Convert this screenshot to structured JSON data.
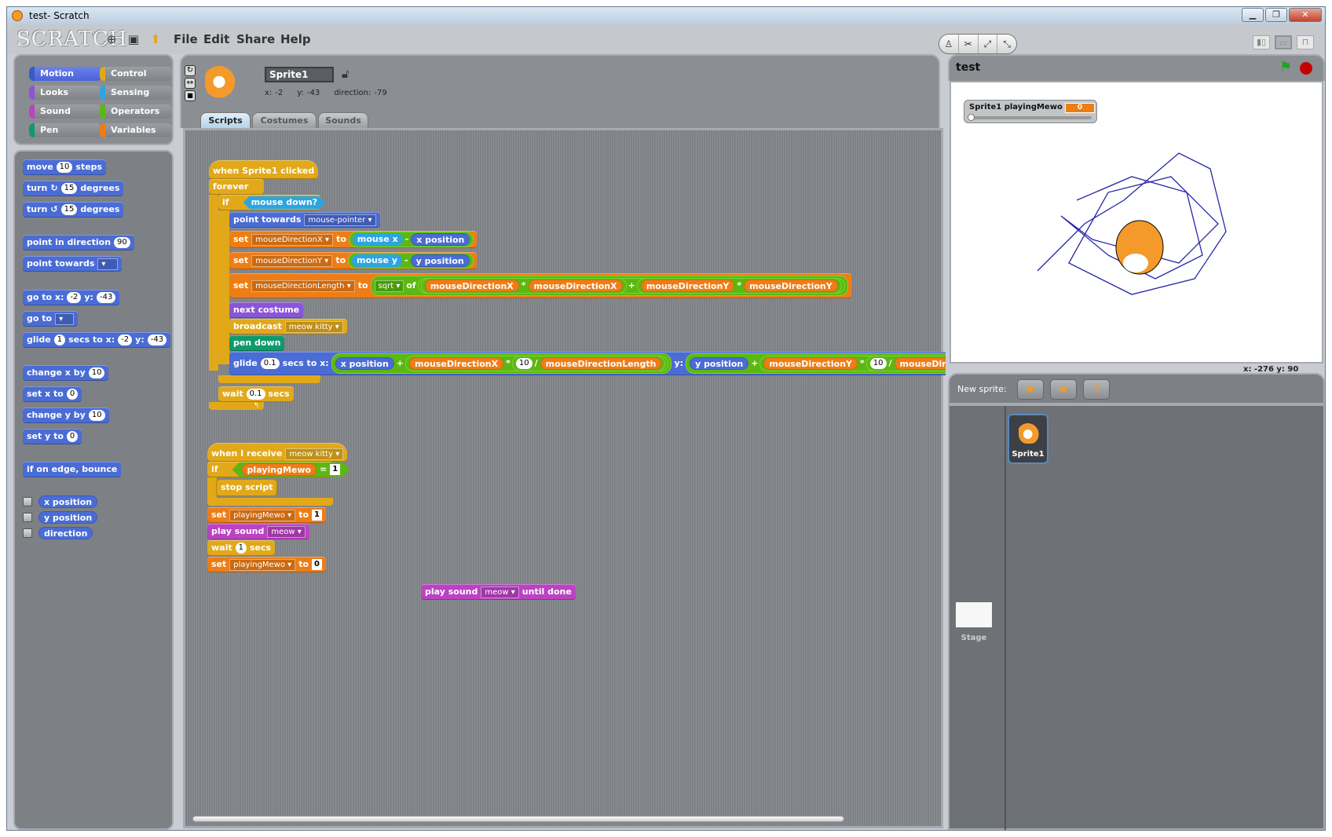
{
  "window": {
    "title": "test- Scratch",
    "min": "▁",
    "max": "❐",
    "close": "✕"
  },
  "menubar": {
    "logo": "SCRATCH",
    "icons": [
      "globe-icon",
      "save-icon",
      "share-icon"
    ],
    "items": [
      "File",
      "Edit",
      "Share",
      "Help"
    ],
    "tools": [
      "stamp-icon",
      "cut-icon",
      "grow-icon",
      "shrink-icon"
    ],
    "tool_glyphs": [
      "♙",
      "✂",
      "⤢",
      "⤡"
    ]
  },
  "categories": [
    {
      "label": "Motion",
      "color": "#4a6cd4",
      "selected": true
    },
    {
      "label": "Control",
      "color": "#e1a91a"
    },
    {
      "label": "Looks",
      "color": "#8a55d7"
    },
    {
      "label": "Sensing",
      "color": "#2ca5e2"
    },
    {
      "label": "Sound",
      "color": "#bb42c3"
    },
    {
      "label": "Operators",
      "color": "#5cb712"
    },
    {
      "label": "Pen",
      "color": "#0e9a6c"
    },
    {
      "label": "Variables",
      "color": "#ee7d16"
    }
  ],
  "palette": {
    "move": {
      "a": "move",
      "n": "10",
      "b": "steps"
    },
    "turn_cw": {
      "a": "turn",
      "g": "↻",
      "n": "15",
      "b": "degrees"
    },
    "turn_ccw": {
      "a": "turn",
      "g": "↺",
      "n": "15",
      "b": "degrees"
    },
    "point_dir": {
      "a": "point in direction",
      "v": "90"
    },
    "point_towards": {
      "a": "point towards",
      "v": ""
    },
    "goto_xy": {
      "a": "go to x:",
      "x": "-2",
      "y_label": "y:",
      "y": "-43"
    },
    "goto": {
      "a": "go to",
      "v": ""
    },
    "glide": {
      "a": "glide",
      "n": "1",
      "b": "secs to x:",
      "x": "-2",
      "y_label": "y:",
      "y": "-43"
    },
    "change_x": {
      "a": "change x by",
      "n": "10"
    },
    "set_x": {
      "a": "set x to",
      "n": "0"
    },
    "change_y": {
      "a": "change y by",
      "n": "10"
    },
    "set_y": {
      "a": "set y to",
      "n": "0"
    },
    "bounce": "if on edge, bounce",
    "reporters": [
      "x position",
      "y position",
      "direction"
    ]
  },
  "sprite": {
    "name": "Sprite1",
    "x_label": "x:",
    "x": "-2",
    "y_label": "y:",
    "y": "-43",
    "dir_label": "direction:",
    "direction": "-79",
    "tabs": [
      "Scripts",
      "Costumes",
      "Sounds"
    ],
    "active_tab": "Scripts"
  },
  "script1": {
    "hat": "when Sprite1 clicked",
    "forever": "forever",
    "if": "if",
    "cond": "mouse down?",
    "point_towards": "point towards",
    "point_target": "mouse-pointer",
    "set": "set",
    "to": "to",
    "var_x": "mouseDirectionX",
    "var_y": "mouseDirectionY",
    "var_len": "mouseDirectionLength",
    "mouse_x": "mouse x",
    "mouse_y": "mouse y",
    "x_pos": "x position",
    "y_pos": "y position",
    "minus": "-",
    "plus": "+",
    "times": "*",
    "div": "/",
    "sqrt": "sqrt",
    "of": "of",
    "next_costume": "next costume",
    "broadcast": "broadcast",
    "msg": "meow kitty",
    "pen_down": "pen down",
    "glide": "glide",
    "glide_secs": "0.1",
    "secs_to_x": "secs to x:",
    "y_label": "y:",
    "ten": "10",
    "wait": "wait",
    "wait_secs": "0.1",
    "secs": "secs"
  },
  "script2": {
    "hat": "when I receive",
    "msg": "meow kitty",
    "if": "if",
    "var": "playingMewo",
    "eq": "=",
    "one": "1",
    "stop": "stop script",
    "set": "set",
    "to": "to",
    "set1": "1",
    "set0": "0",
    "play": "play sound",
    "sound": "meow",
    "wait": "wait",
    "wait_n": "1",
    "secs": "secs"
  },
  "loose": {
    "a": "play sound",
    "sound": "meow",
    "b": "until done"
  },
  "stage": {
    "title": "test",
    "monitor_label": "Sprite1 playingMewo",
    "monitor_value": "0",
    "slider_value": 0,
    "coords": "x: -276   y: 90"
  },
  "sprites": {
    "new_label": "New sprite:",
    "new_buttons": [
      "paint-new-sprite",
      "choose-sprite-file",
      "random-sprite"
    ],
    "list": [
      {
        "name": "Sprite1",
        "selected": true
      }
    ],
    "stage_label": "Stage"
  }
}
